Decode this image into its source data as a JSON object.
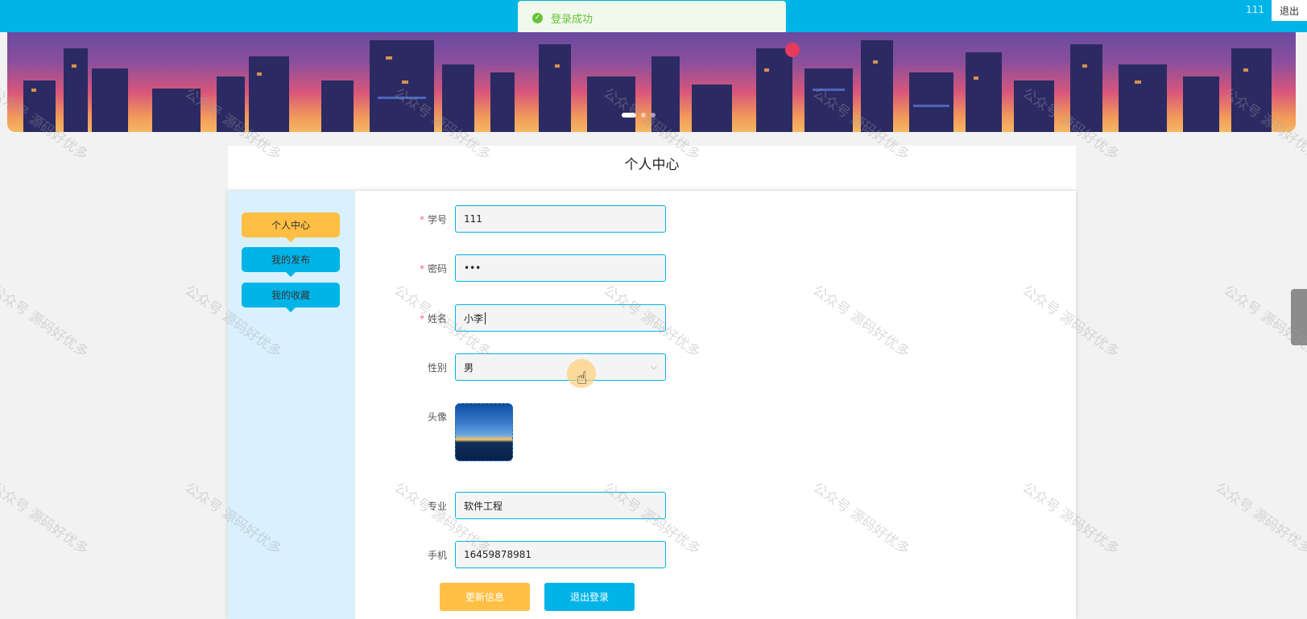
{
  "header": {
    "username": "111",
    "logout_label": "退出",
    "accent": "#00b4e8"
  },
  "toast": {
    "message": "登录成功",
    "icon": "check-circle-icon",
    "color": "#67c23a"
  },
  "banner": {
    "slide_count": 3,
    "active_slide": 1
  },
  "page": {
    "title": "个人中心"
  },
  "sidebar": {
    "items": [
      {
        "label": "个人中心",
        "active": true
      },
      {
        "label": "我的发布",
        "active": false
      },
      {
        "label": "我的收藏",
        "active": false
      }
    ]
  },
  "form": {
    "student_id": {
      "label": "学号",
      "value": "111",
      "required": true
    },
    "password": {
      "label": "密码",
      "value": "•••",
      "required": true
    },
    "name": {
      "label": "姓名",
      "value": "小李",
      "required": true
    },
    "gender": {
      "label": "性别",
      "value": "男"
    },
    "avatar": {
      "label": "头像"
    },
    "major": {
      "label": "专业",
      "value": "软件工程"
    },
    "phone": {
      "label": "手机",
      "value": "16459878981"
    }
  },
  "buttons": {
    "update": "更新信息",
    "logout": "退出登录"
  },
  "watermark": "公众号 源码好优多"
}
